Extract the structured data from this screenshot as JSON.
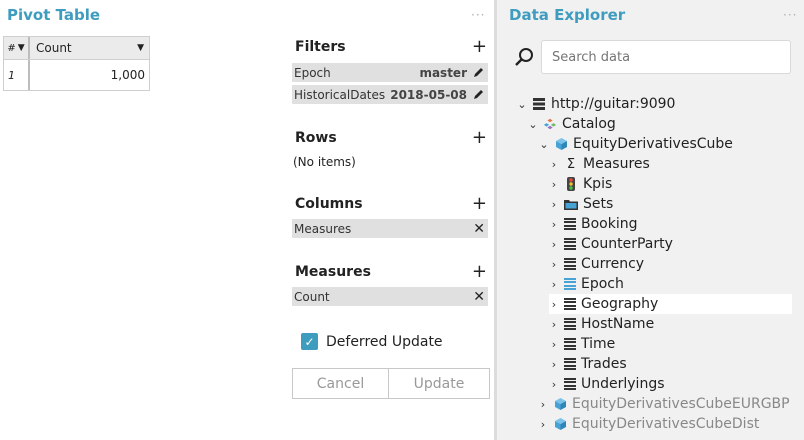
{
  "pivot": {
    "title": "Pivot Table",
    "dots": "···",
    "grid": {
      "index_header": "#",
      "column_header": "Count",
      "rows": [
        {
          "index": "1",
          "value": "1,000"
        }
      ]
    },
    "filters": {
      "label": "Filters",
      "items": [
        {
          "name": "Epoch",
          "value": "master"
        },
        {
          "name": "HistoricalDates",
          "value": "2018-05-08"
        }
      ]
    },
    "rows": {
      "label": "Rows",
      "empty_text": "(No items)"
    },
    "columns": {
      "label": "Columns",
      "items": [
        "Measures"
      ]
    },
    "measures": {
      "label": "Measures",
      "items": [
        "Count"
      ]
    },
    "deferred_update": {
      "label": "Deferred Update",
      "checked": true
    },
    "buttons": {
      "cancel": "Cancel",
      "update": "Update"
    }
  },
  "explorer": {
    "title": "Data Explorer",
    "dots": "···",
    "search_placeholder": "Search data",
    "tree": {
      "server": "http://guitar:9090",
      "catalog": "Catalog",
      "cube": "EquityDerivativesCube",
      "children": [
        {
          "label": "Measures",
          "icon": "sigma-icon"
        },
        {
          "label": "Kpis",
          "icon": "traffic-light-icon"
        },
        {
          "label": "Sets",
          "icon": "folder-icon"
        },
        {
          "label": "Booking",
          "icon": "dimension-icon"
        },
        {
          "label": "CounterParty",
          "icon": "dimension-icon"
        },
        {
          "label": "Currency",
          "icon": "dimension-icon"
        },
        {
          "label": "Epoch",
          "icon": "epoch-dimension-icon"
        },
        {
          "label": "Geography",
          "icon": "dimension-icon"
        },
        {
          "label": "HostName",
          "icon": "dimension-icon"
        },
        {
          "label": "Time",
          "icon": "dimension-icon"
        },
        {
          "label": "Trades",
          "icon": "dimension-icon"
        },
        {
          "label": "Underlyings",
          "icon": "dimension-icon"
        }
      ],
      "other_cubes": [
        "EquityDerivativesCubeEURGBP",
        "EquityDerivativesCubeDist"
      ]
    }
  },
  "colors": {
    "accent": "#3e9cbf",
    "cube_blue": "#47a3d6"
  }
}
